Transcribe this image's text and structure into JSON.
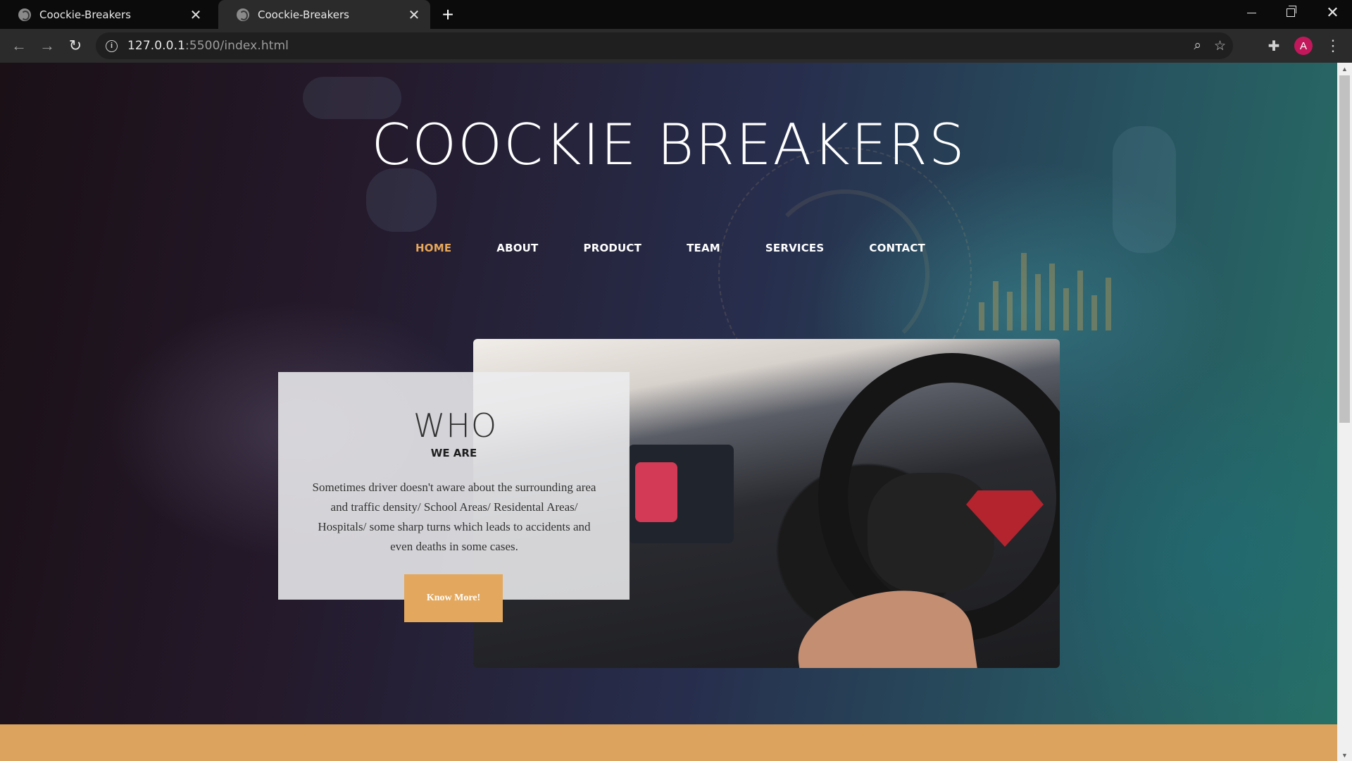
{
  "browser": {
    "tabs": [
      {
        "title": "Coockie-Breakers",
        "active": false
      },
      {
        "title": "Coockie-Breakers",
        "active": true
      }
    ],
    "new_tab_symbol": "+",
    "url_host": "127.0.0.1",
    "url_path": ":5500/index.html",
    "avatar_letter": "A"
  },
  "site": {
    "title": "COOCKIE BREAKERS",
    "nav": [
      {
        "label": "HOME",
        "active": true
      },
      {
        "label": "ABOUT",
        "active": false
      },
      {
        "label": "PRODUCT",
        "active": false
      },
      {
        "label": "TEAM",
        "active": false
      },
      {
        "label": "SERVICES",
        "active": false
      },
      {
        "label": "CONTACT",
        "active": false
      }
    ],
    "about_card": {
      "heading": "WHO",
      "subheading": "WE ARE",
      "description": "Sometimes driver doesn't aware about the surrounding area and traffic density/ School Areas/ Residental Areas/ Hospitals/ some sharp turns which leads to accidents and even deaths in some cases.",
      "button_label": "Know More!"
    }
  },
  "colors": {
    "accent": "#e3a85e",
    "nav_active": "#e8a85a",
    "footer_band": "#dba35e",
    "avatar": "#c2185b"
  },
  "icons": {
    "tab_favicon": "globe-icon",
    "tab_close": "close-icon",
    "back": "arrow-left-icon",
    "forward": "arrow-right-icon",
    "reload": "reload-icon",
    "site_info": "info-icon",
    "zoom": "zoom-out-icon",
    "bookmark": "star-icon",
    "extensions": "puzzle-icon",
    "menu": "kebab-menu-icon"
  }
}
